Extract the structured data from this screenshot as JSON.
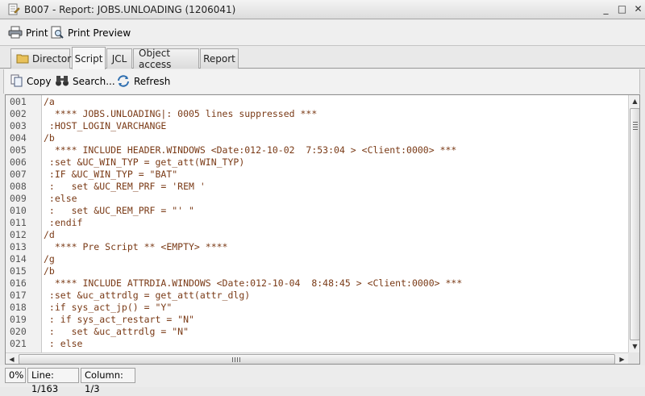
{
  "window": {
    "title": "B007 - Report: JOBS.UNLOADING (1206041)",
    "minimize_glyph": "_",
    "maximize_glyph": "□",
    "close_glyph": "✕"
  },
  "toolbar": {
    "print_label": "Print",
    "print_preview_label": "Print Preview"
  },
  "tabs": [
    {
      "label": "Directory"
    },
    {
      "label": "Script"
    },
    {
      "label": "JCL"
    },
    {
      "label": "Object access"
    },
    {
      "label": "Report"
    }
  ],
  "active_tab": "Script",
  "subtoolbar": {
    "copy_label": "Copy",
    "search_label": "Search...",
    "refresh_label": "Refresh"
  },
  "editor": {
    "lines": [
      {
        "num": "001",
        "text": "/a"
      },
      {
        "num": "002",
        "text": "  **** JOBS.UNLOADING|: 0005 lines suppressed ***"
      },
      {
        "num": "003",
        "text": " :HOST_LOGIN_VARCHANGE"
      },
      {
        "num": "004",
        "text": "/b"
      },
      {
        "num": "005",
        "text": "  **** INCLUDE HEADER.WINDOWS <Date:012-10-02  7:53:04 > <Client:0000> ***"
      },
      {
        "num": "006",
        "text": " :set &UC_WIN_TYP = get_att(WIN_TYP)"
      },
      {
        "num": "007",
        "text": " :IF &UC_WIN_TYP = \"BAT\""
      },
      {
        "num": "008",
        "text": " :   set &UC_REM_PRF = 'REM '"
      },
      {
        "num": "009",
        "text": " :else"
      },
      {
        "num": "010",
        "text": " :   set &UC_REM_PRF = \"' \""
      },
      {
        "num": "011",
        "text": " :endif"
      },
      {
        "num": "012",
        "text": "/d"
      },
      {
        "num": "013",
        "text": "  **** Pre Script ** <EMPTY> ****"
      },
      {
        "num": "014",
        "text": "/g"
      },
      {
        "num": "015",
        "text": "/b"
      },
      {
        "num": "016",
        "text": "  **** INCLUDE ATTRDIA.WINDOWS <Date:012-10-04  8:48:45 > <Client:0000> ***"
      },
      {
        "num": "017",
        "text": " :set &uc_attrdlg = get_att(attr_dlg)"
      },
      {
        "num": "018",
        "text": " :if sys_act_jp() = \"Y\""
      },
      {
        "num": "019",
        "text": " : if sys_act_restart = \"N\""
      },
      {
        "num": "020",
        "text": " :   set &uc_attrdlg = \"N\""
      },
      {
        "num": "021",
        "text": " : else"
      }
    ],
    "vertical_scroll_position": 0.0
  },
  "status": {
    "percent": "0%",
    "line": "Line: 1/163",
    "column": "Column: 1/3"
  },
  "colors": {
    "code_text": "#7a3a16",
    "line_number": "#555555"
  }
}
